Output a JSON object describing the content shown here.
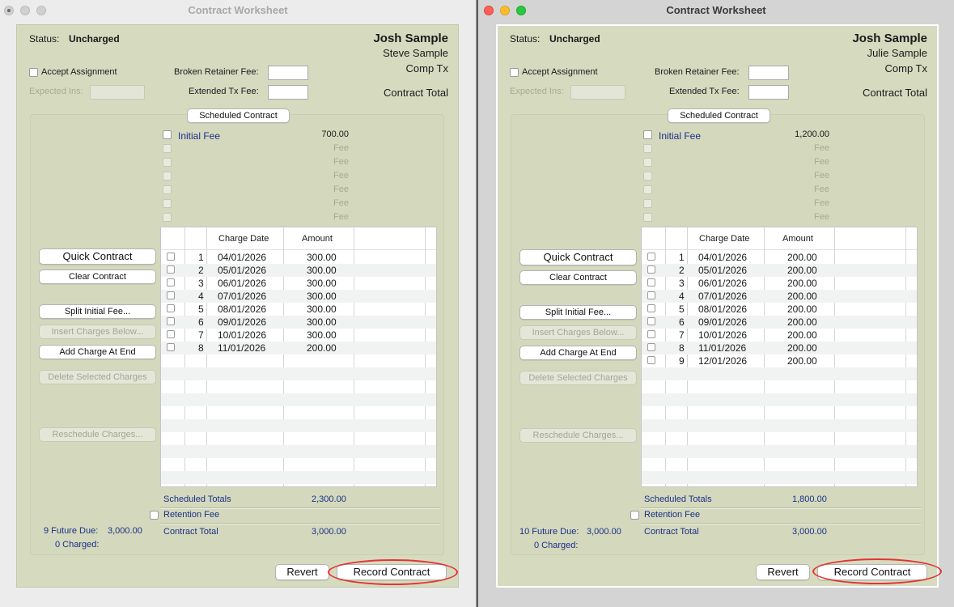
{
  "windows": [
    {
      "title": "Contract Worksheet",
      "status_label": "Status:",
      "status_value": "Uncharged",
      "patient_name": "Josh Sample",
      "guarantor_name": "Steve Sample",
      "treatment": "Comp Tx",
      "contract_total_label": "Contract Total",
      "accept_assignment_label": "Accept Assignment",
      "expected_ins_label": "Expected Ins:",
      "broken_retainer_fee_label": "Broken Retainer Fee:",
      "extended_tx_fee_label": "Extended Tx Fee:",
      "scheduled_contract_button": "Scheduled Contract",
      "fees": [
        {
          "label": "Initial Fee",
          "amount": "700.00"
        },
        {
          "label": "",
          "amount": "Fee"
        },
        {
          "label": "",
          "amount": "Fee"
        },
        {
          "label": "",
          "amount": "Fee"
        },
        {
          "label": "",
          "amount": "Fee"
        },
        {
          "label": "",
          "amount": "Fee"
        },
        {
          "label": "",
          "amount": "Fee"
        }
      ],
      "buttons": {
        "quick_contract": "Quick Contract",
        "clear_contract": "Clear Contract",
        "split_initial_fee": "Split Initial Fee...",
        "insert_charges_below": "Insert Charges Below...",
        "add_charge_at_end": "Add Charge At End",
        "delete_selected_charges": "Delete Selected Charges",
        "reschedule_charges": "Reschedule Charges...",
        "revert": "Revert",
        "record_contract": "Record Contract"
      },
      "table": {
        "columns": [
          "Charge Date",
          "Amount"
        ],
        "rows": [
          {
            "num": "1",
            "date": "04/01/2026",
            "amount": "300.00"
          },
          {
            "num": "2",
            "date": "05/01/2026",
            "amount": "300.00"
          },
          {
            "num": "3",
            "date": "06/01/2026",
            "amount": "300.00"
          },
          {
            "num": "4",
            "date": "07/01/2026",
            "amount": "300.00"
          },
          {
            "num": "5",
            "date": "08/01/2026",
            "amount": "300.00"
          },
          {
            "num": "6",
            "date": "09/01/2026",
            "amount": "300.00"
          },
          {
            "num": "7",
            "date": "10/01/2026",
            "amount": "300.00"
          },
          {
            "num": "8",
            "date": "11/01/2026",
            "amount": "200.00"
          }
        ]
      },
      "scheduled_totals_label": "Scheduled Totals",
      "scheduled_totals_value": "2,300.00",
      "retention_fee_label": "Retention Fee",
      "contract_total_bottom_label": "Contract Total",
      "contract_total_value": "3,000.00",
      "future_due_label": "9 Future Due:",
      "future_due_value": "3,000.00",
      "charged_label": "0 Charged:"
    },
    {
      "title": "Contract Worksheet",
      "status_label": "Status:",
      "status_value": "Uncharged",
      "patient_name": "Josh Sample",
      "guarantor_name": "Julie Sample",
      "treatment": "Comp Tx",
      "contract_total_label": "Contract Total",
      "accept_assignment_label": "Accept Assignment",
      "expected_ins_label": "Expected Ins:",
      "broken_retainer_fee_label": "Broken Retainer Fee:",
      "extended_tx_fee_label": "Extended Tx Fee:",
      "scheduled_contract_button": "Scheduled Contract",
      "fees": [
        {
          "label": "Initial Fee",
          "amount": "1,200.00"
        },
        {
          "label": "",
          "amount": "Fee"
        },
        {
          "label": "",
          "amount": "Fee"
        },
        {
          "label": "",
          "amount": "Fee"
        },
        {
          "label": "",
          "amount": "Fee"
        },
        {
          "label": "",
          "amount": "Fee"
        },
        {
          "label": "",
          "amount": "Fee"
        }
      ],
      "buttons": {
        "quick_contract": "Quick Contract",
        "clear_contract": "Clear Contract",
        "split_initial_fee": "Split Initial Fee...",
        "insert_charges_below": "Insert Charges Below...",
        "add_charge_at_end": "Add Charge At End",
        "delete_selected_charges": "Delete Selected Charges",
        "reschedule_charges": "Reschedule Charges...",
        "revert": "Revert",
        "record_contract": "Record Contract"
      },
      "table": {
        "columns": [
          "Charge Date",
          "Amount"
        ],
        "rows": [
          {
            "num": "1",
            "date": "04/01/2026",
            "amount": "200.00"
          },
          {
            "num": "2",
            "date": "05/01/2026",
            "amount": "200.00"
          },
          {
            "num": "3",
            "date": "06/01/2026",
            "amount": "200.00"
          },
          {
            "num": "4",
            "date": "07/01/2026",
            "amount": "200.00"
          },
          {
            "num": "5",
            "date": "08/01/2026",
            "amount": "200.00"
          },
          {
            "num": "6",
            "date": "09/01/2026",
            "amount": "200.00"
          },
          {
            "num": "7",
            "date": "10/01/2026",
            "amount": "200.00"
          },
          {
            "num": "8",
            "date": "11/01/2026",
            "amount": "200.00"
          },
          {
            "num": "9",
            "date": "12/01/2026",
            "amount": "200.00"
          }
        ]
      },
      "scheduled_totals_label": "Scheduled Totals",
      "scheduled_totals_value": "1,800.00",
      "retention_fee_label": "Retention Fee",
      "contract_total_bottom_label": "Contract Total",
      "contract_total_value": "3,000.00",
      "future_due_label": "10 Future Due:",
      "future_due_value": "3,000.00",
      "charged_label": "0 Charged:"
    }
  ],
  "colors": {
    "panel_background": "#d6dbc0",
    "link_blue": "#1c2f88",
    "highlight_red": "#e43333",
    "traffic_close": "#ff5f57",
    "traffic_minimize": "#febc2e",
    "traffic_zoom": "#28c840"
  }
}
